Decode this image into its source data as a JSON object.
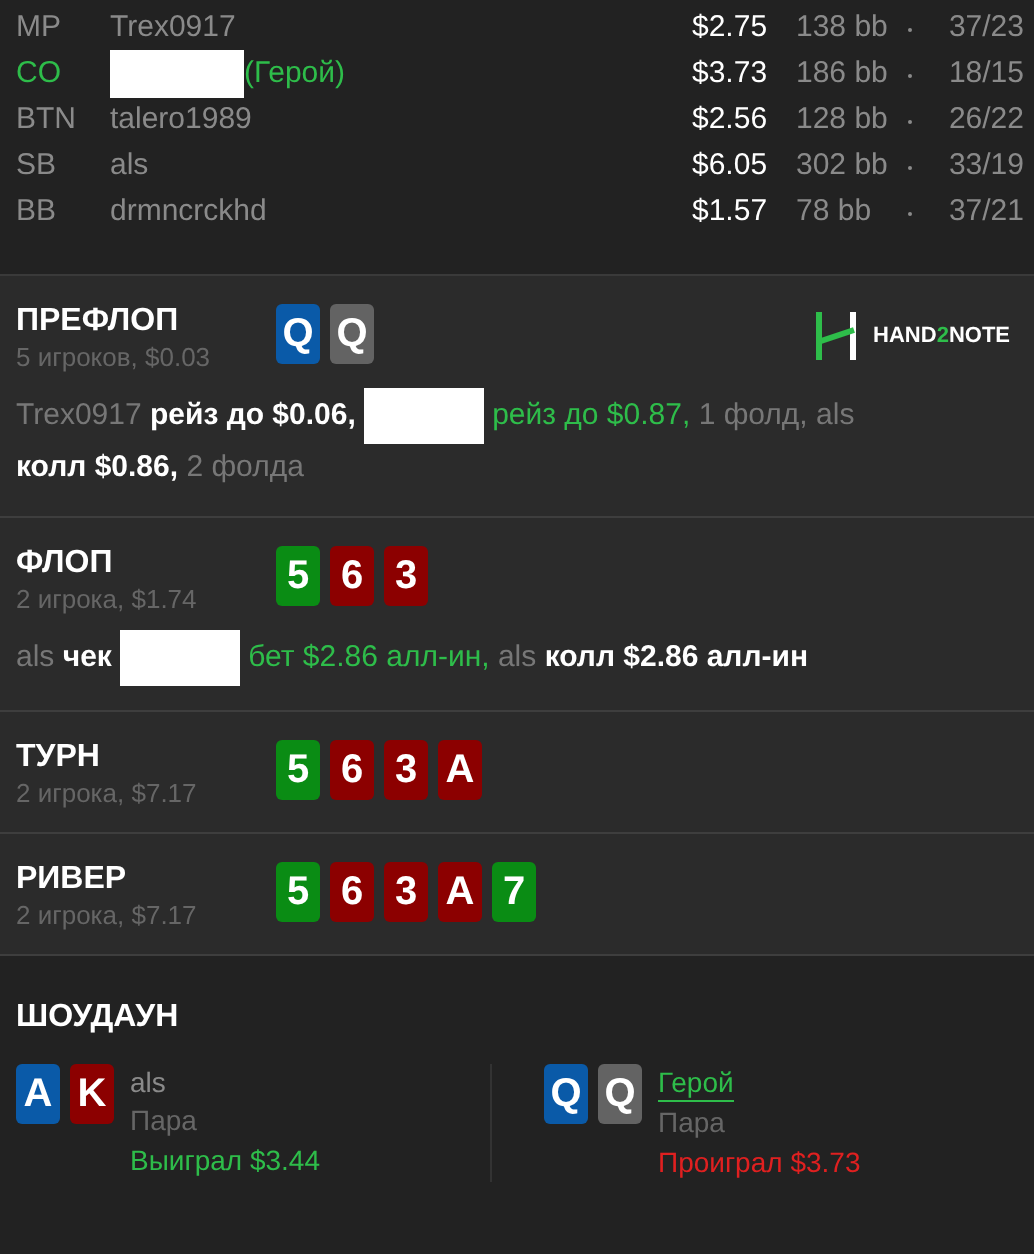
{
  "players": [
    {
      "position": "MP",
      "name": "Trex0917",
      "hero": false,
      "redacted": false,
      "stack": "$2.75",
      "bb": "138 bb",
      "stats": "37/23"
    },
    {
      "position": "CO",
      "tag": "(Герой)",
      "hero": true,
      "redacted": true,
      "stack": "$3.73",
      "bb": "186 bb",
      "stats": "18/15"
    },
    {
      "position": "BTN",
      "name": "talero1989",
      "hero": false,
      "redacted": false,
      "stack": "$2.56",
      "bb": "128 bb",
      "stats": "26/22"
    },
    {
      "position": "SB",
      "name": "als",
      "hero": false,
      "redacted": false,
      "stack": "$6.05",
      "bb": "302 bb",
      "stats": "33/19"
    },
    {
      "position": "BB",
      "name": "drmncrckhd",
      "hero": false,
      "redacted": false,
      "stack": "$1.57",
      "bb": "78 bb",
      "stats": "37/21"
    }
  ],
  "logo": "HAND**2**NOTE",
  "streets": [
    {
      "title": "ПРЕФЛОП",
      "subtitle": "5 игроков, $0.03",
      "logo": true,
      "cards": [
        {
          "rank": "Q",
          "color": "#0a5aa8"
        },
        {
          "rank": "Q",
          "color": "#636363"
        }
      ],
      "actions": [
        {
          "kind": "name",
          "text": "Trex0917"
        },
        {
          "kind": "action",
          "text": "рейз до $0.06,"
        },
        {
          "kind": "redacted"
        },
        {
          "kind": "hero",
          "text": "рейз до $0.87,"
        },
        {
          "kind": "muted",
          "text": "1 фолд,"
        },
        {
          "kind": "name",
          "text": "als"
        },
        {
          "kind": "action",
          "text": "колл $0.86,"
        },
        {
          "kind": "muted",
          "text": "2 фолда"
        }
      ]
    },
    {
      "title": "ФЛОП",
      "subtitle": "2 игрока, $1.74",
      "logo": false,
      "cards": [
        {
          "rank": "5",
          "color": "#0a8c14"
        },
        {
          "rank": "6",
          "color": "#8c0000"
        },
        {
          "rank": "3",
          "color": "#8c0000"
        }
      ],
      "actions": [
        {
          "kind": "name",
          "text": "als"
        },
        {
          "kind": "action",
          "text": "чек"
        },
        {
          "kind": "redacted"
        },
        {
          "kind": "hero",
          "text": "бет $2.86 алл-ин,"
        },
        {
          "kind": "name",
          "text": "als"
        },
        {
          "kind": "action",
          "text": "колл $2.86 алл-ин"
        }
      ]
    },
    {
      "title": "ТУРН",
      "subtitle": "2 игрока, $7.17",
      "logo": false,
      "cards": [
        {
          "rank": "5",
          "color": "#0a8c14"
        },
        {
          "rank": "6",
          "color": "#8c0000"
        },
        {
          "rank": "3",
          "color": "#8c0000"
        },
        {
          "rank": "A",
          "color": "#8c0000"
        }
      ]
    },
    {
      "title": "РИВЕР",
      "subtitle": "2 игрока, $7.17",
      "logo": false,
      "cards": [
        {
          "rank": "5",
          "color": "#0a8c14"
        },
        {
          "rank": "6",
          "color": "#8c0000"
        },
        {
          "rank": "3",
          "color": "#8c0000"
        },
        {
          "rank": "A",
          "color": "#8c0000"
        },
        {
          "rank": "7",
          "color": "#0a8c14"
        }
      ]
    }
  ],
  "showdown": {
    "title": "ШОУДАУН",
    "hands": [
      {
        "cards": [
          {
            "rank": "A",
            "color": "#0a5aa8"
          },
          {
            "rank": "K",
            "color": "#8c0000"
          }
        ],
        "name": "als",
        "hero": false,
        "combo": "Пара",
        "result": "Выиграл $3.44",
        "won": true
      },
      {
        "cards": [
          {
            "rank": "Q",
            "color": "#0a5aa8"
          },
          {
            "rank": "Q",
            "color": "#636363"
          }
        ],
        "name": "Герой",
        "hero": true,
        "combo": "Пара",
        "result": "Проиграл $3.73",
        "won": false
      }
    ]
  }
}
